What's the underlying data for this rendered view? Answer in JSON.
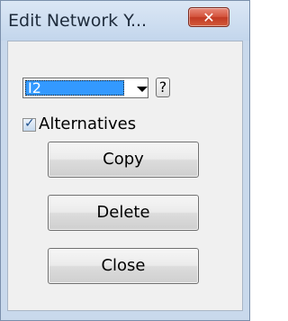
{
  "window": {
    "title": "Edit Network Y...",
    "close_glyph": "✕"
  },
  "combo": {
    "selected_value": "I2",
    "help_label": "?"
  },
  "alternatives": {
    "label": "Alternatives",
    "checked": true,
    "check_glyph": "✓"
  },
  "buttons": {
    "copy": "Copy",
    "delete": "Delete",
    "close": "Close"
  },
  "icons": {
    "close": "close-icon",
    "dropdown": "chevron-down-icon",
    "check": "checkmark-icon"
  }
}
